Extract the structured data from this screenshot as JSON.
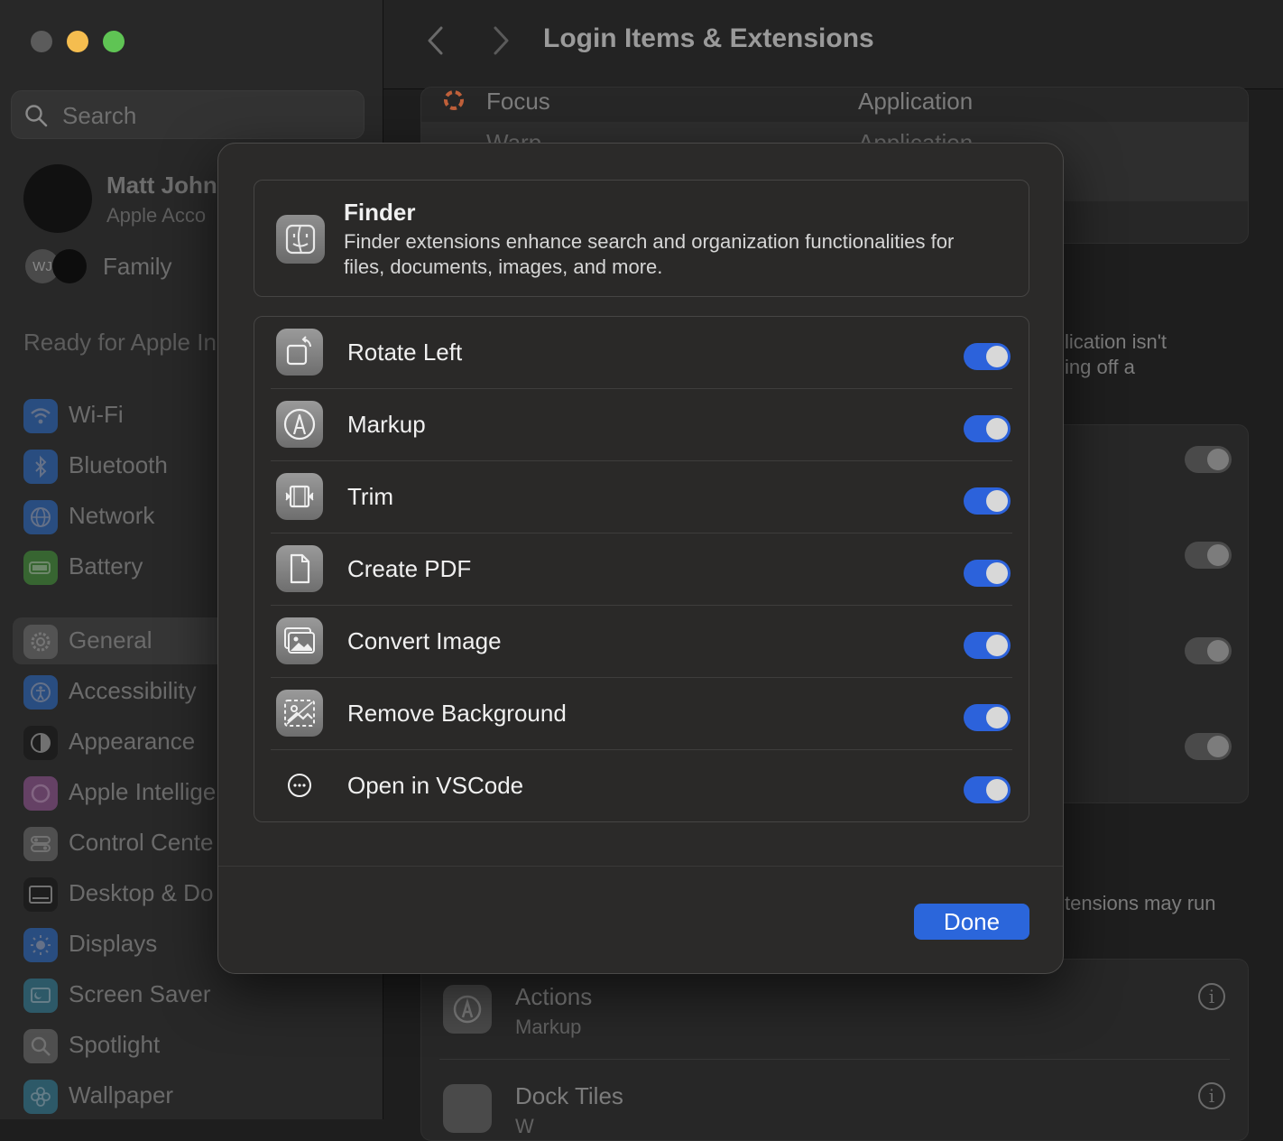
{
  "window": {
    "title": "Login Items & Extensions"
  },
  "sidebar": {
    "search_placeholder": "Search",
    "account_name": "Matt John",
    "account_sub": "Apple Acco",
    "family_initials": "WJ",
    "family_label": "Family",
    "ready_label": "Ready for Apple In",
    "items": [
      {
        "label": "Wi-Fi",
        "icon": "wifi-icon",
        "color": "#2a5a9e"
      },
      {
        "label": "Bluetooth",
        "icon": "bluetooth-icon",
        "color": "#2a5a9e"
      },
      {
        "label": "Network",
        "icon": "network-globe-icon",
        "color": "#2a5a9e"
      },
      {
        "label": "Battery",
        "icon": "battery-icon",
        "color": "#3c7a35"
      },
      {
        "label": "General",
        "icon": "gear-icon",
        "color": "#5d5d5d"
      },
      {
        "label": "Accessibility",
        "icon": "accessibility-icon",
        "color": "#2a5a9e"
      },
      {
        "label": "Appearance",
        "icon": "appearance-icon",
        "color": "#1a1a1a"
      },
      {
        "label": "Apple Intellige",
        "icon": "apple-intelligence-icon",
        "color": "#7a4a7a"
      },
      {
        "label": "Control Cente",
        "icon": "control-center-icon",
        "color": "#5d5d5d"
      },
      {
        "label": "Desktop & Do",
        "icon": "desktop-dock-icon",
        "color": "#1a1a1a"
      },
      {
        "label": "Displays",
        "icon": "displays-icon",
        "color": "#2a5a9e"
      },
      {
        "label": "Screen Saver",
        "icon": "screen-saver-icon",
        "color": "#2f6a7e"
      },
      {
        "label": "Spotlight",
        "icon": "spotlight-icon",
        "color": "#5d5d5d"
      },
      {
        "label": "Wallpaper",
        "icon": "wallpaper-icon",
        "color": "#2f6a7e"
      }
    ]
  },
  "background": {
    "top_rows": [
      {
        "name": "Focus",
        "kind": "Application"
      },
      {
        "name": "Warp",
        "kind": "Application"
      }
    ],
    "note_1": "lication isn't",
    "note_2": "ing off a",
    "note_3": "tensions may run",
    "ext_rows": [
      {
        "title": "Actions",
        "subtitle": "Markup"
      },
      {
        "title": "Dock Tiles",
        "subtitle": "W"
      }
    ]
  },
  "sheet": {
    "header": {
      "title": "Finder",
      "description": "Finder extensions enhance search and organization functionalities for files, documents, images, and more."
    },
    "extensions": [
      {
        "label": "Rotate Left",
        "icon": "rotate-left-icon",
        "enabled": true
      },
      {
        "label": "Markup",
        "icon": "markup-pen-icon",
        "enabled": true
      },
      {
        "label": "Trim",
        "icon": "trim-video-icon",
        "enabled": true
      },
      {
        "label": "Create PDF",
        "icon": "document-icon",
        "enabled": true
      },
      {
        "label": "Convert Image",
        "icon": "photos-icon",
        "enabled": true
      },
      {
        "label": "Remove Background",
        "icon": "remove-background-icon",
        "enabled": true
      },
      {
        "label": "Open in VSCode",
        "icon": "ellipsis-circle-icon",
        "enabled": true
      }
    ],
    "done_label": "Done"
  },
  "colors": {
    "accent": "#2b66db",
    "toggle_on": "#2c62db"
  }
}
